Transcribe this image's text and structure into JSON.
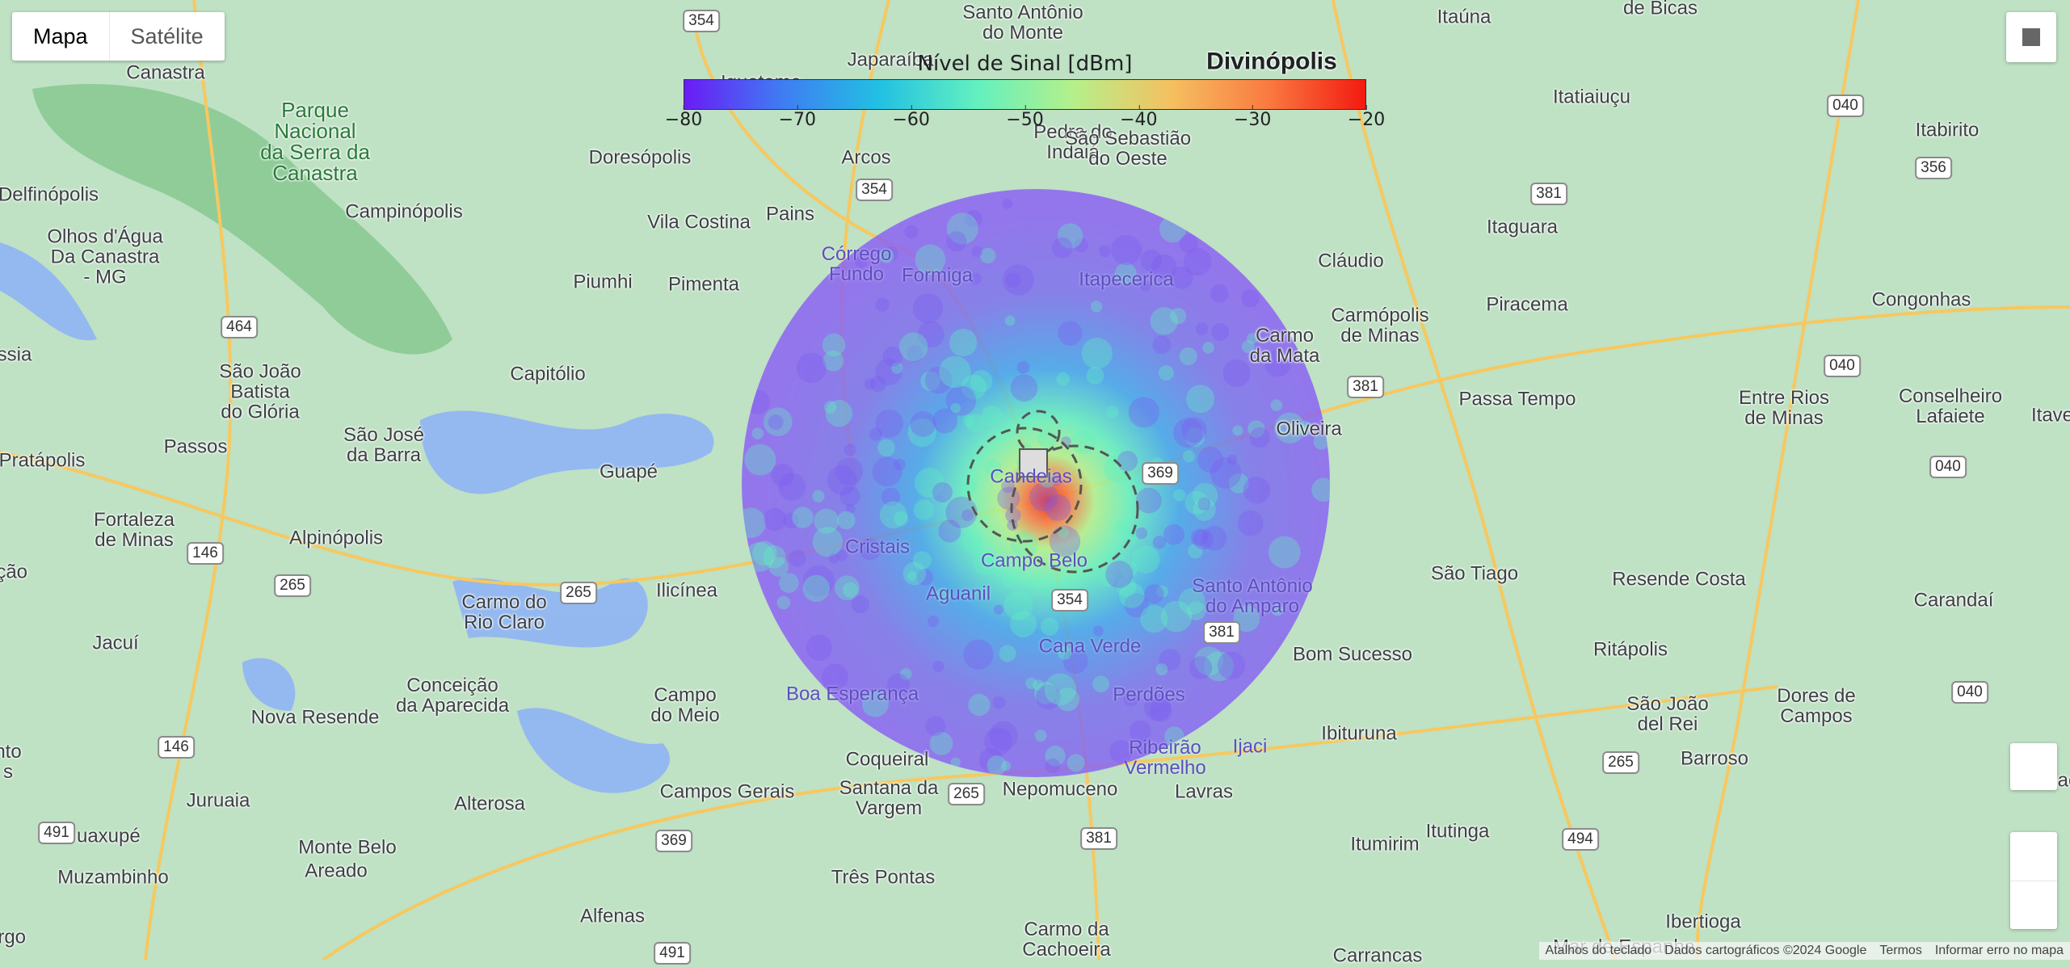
{
  "map_type": {
    "map_label": "Mapa",
    "satellite_label": "Satélite"
  },
  "legend": {
    "title": "Nível de Sinal [dBm]",
    "ticks": [
      "−80",
      "−70",
      "−60",
      "−50",
      "−40",
      "−30",
      "−20"
    ],
    "min": -80,
    "max": -20,
    "colors": [
      "#6a1bf5",
      "#3f7cf3",
      "#22c0e3",
      "#62f0c0",
      "#b5f08a",
      "#f5c060",
      "#fa7a40",
      "#f31a10"
    ]
  },
  "places": [
    "Santo Antônio\ndo Monte",
    "Itaúna",
    "de Bicas",
    "Divinópolis",
    "Japaraíba",
    "Iguatama",
    "Canastra",
    "Parque\nNacional\nda Serra da\nCanastra",
    "Doresópolis",
    "Arcos",
    "Pedra do\nIndaiá",
    "São Sebastião\ndo Oeste",
    "Itatiaiuçu",
    "Itabirito",
    "Delfinópolis",
    "Campinópolis",
    "Vila Costina",
    "Pains",
    "Itaguara",
    "Olhos d'Água\nDa Canastra\n- MG",
    "Piumhi",
    "Pimenta",
    "Córrego\nFundo",
    "Formiga",
    "Itapecerica",
    "Cláudio",
    "Carmópolis\nde Minas",
    "Piracema",
    "Congonhas",
    "ssia",
    "São João\nBatista\ndo Glória",
    "Capitólio",
    "Carmo\nda Mata",
    "Passa Tempo",
    "Entre Rios\nde Minas",
    "Conselheiro\nLafaiete",
    "Itave",
    "Pratápolis",
    "Passos",
    "São José\nda Barra",
    "Guapé",
    "Candeias",
    "Oliveira",
    "Fortaleza\nde Minas",
    "Alpinópolis",
    "Cristais",
    "Campo Belo",
    "São Tiago",
    "Resende Costa",
    "Carandaí",
    "Aguanil",
    "Santo Antônio\ndo Amparo",
    "Carmo do\nRio Claro",
    "Ilicínea",
    "Jacuí",
    "Cana Verde",
    "Bom Sucesso",
    "Ritápolis",
    "Conceição\nda Aparecida",
    "Campo\ndo Meio",
    "Boa Esperança",
    "Perdões",
    "Nova Resende",
    "São João\ndel Rei",
    "Dores de\nCampos",
    "Coqueiral",
    "Ribeirão\nVermelho",
    "Ijaci",
    "Ibituruna",
    "Barroso",
    "Barbacena",
    "Juruaia",
    "Campos Gerais",
    "Santana da\nVargem",
    "Nepomuceno",
    "Lavras",
    "Alterosa",
    "Guaxupé",
    "Itumirim",
    "Itutinga",
    "Monte Belo",
    "Areado",
    "Muzambinho",
    "Três Pontas",
    "Alfenas",
    "Carmo da\nCachoeira",
    "Ibertioga",
    "Carrancas",
    "Mar de Espanha",
    "ição",
    "nto\ns",
    "urgo"
  ],
  "shields": [
    "354",
    "354",
    "040",
    "356",
    "381",
    "464",
    "381",
    "369",
    "146",
    "265",
    "265",
    "354",
    "381",
    "146",
    "265",
    "040",
    "040",
    "040",
    "265",
    "369",
    "491",
    "381",
    "494",
    "491"
  ],
  "footer": {
    "shortcuts": "Atalhos do teclado",
    "map_data": "Dados cartográficos ©2024 Google",
    "terms": "Termos",
    "report": "Informar erro no mapa"
  },
  "colors": {
    "land": "#bfe1c4",
    "water": "#8fb4f5",
    "road_major": "#f6c85f",
    "road_minor": "#ffffff",
    "park": "#7fc48a"
  }
}
